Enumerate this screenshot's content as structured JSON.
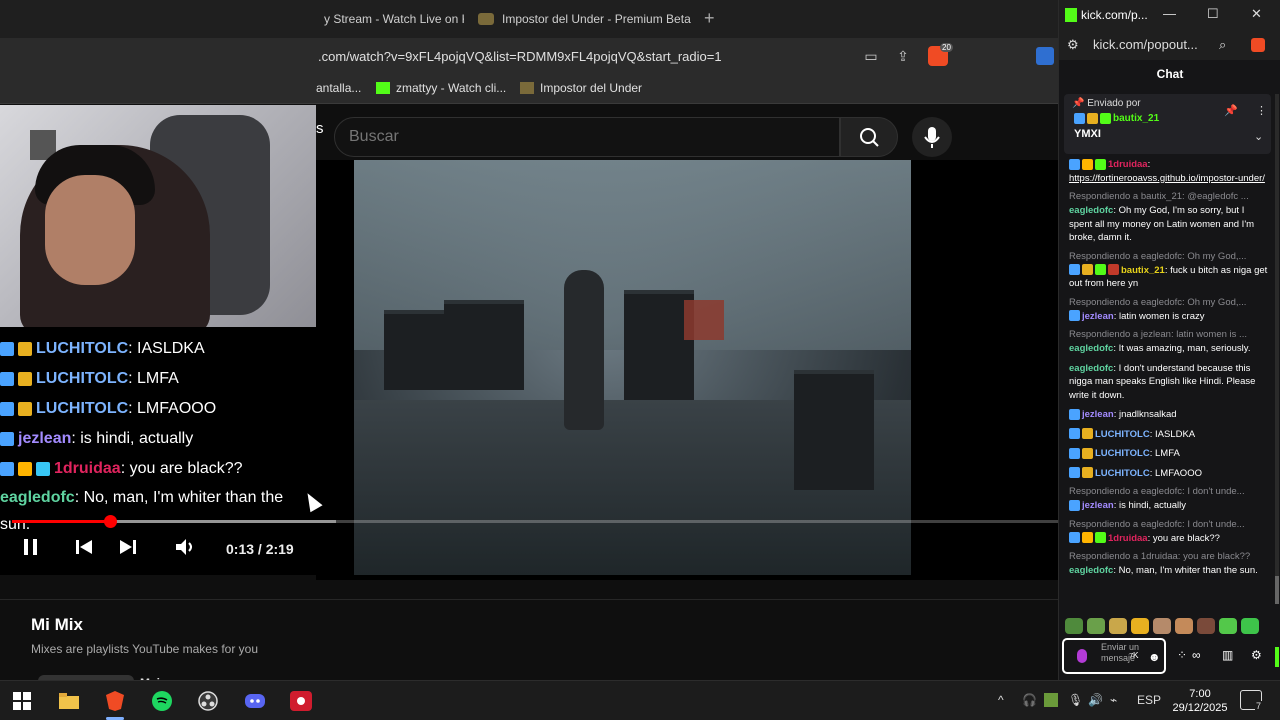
{
  "browser": {
    "tabs": [
      {
        "label": "y Stream - Watch Live on K",
        "favicon_color": "#53fc18"
      },
      {
        "label": "Impostor del Under - Premium Beta",
        "favicon_color": "#7a6a3a"
      }
    ],
    "new_tab": "+",
    "url": ".com/watch?v=9xFL4pojqVQ&list=RDMM9xFL4pojqVQ&start_radio=1",
    "brave_count": "20",
    "bookmarks": [
      {
        "label": "antalla...",
        "color": "#888888"
      },
      {
        "label": "zmattyy - Watch cli...",
        "color": "#53fc18"
      },
      {
        "label": "Impostor del Under",
        "color": "#7a6a3a"
      }
    ]
  },
  "youtube": {
    "logo_fragment": "s",
    "search_placeholder": "Buscar",
    "player": {
      "current_time": "0:13",
      "duration": "2:19",
      "time_display": "0:13 / 2:19",
      "progress": 0.094,
      "buffered": 0.31
    },
    "mix": {
      "title": "Mi Mix",
      "subtitle": "Mixes are playlists YouTube makes for you",
      "next_title": "Majora"
    }
  },
  "overlay_chat": [
    {
      "user": "LUCHITOLC",
      "text": ": IASLDKA",
      "color": "#7db4ff",
      "badges": [
        "sword",
        "sub"
      ]
    },
    {
      "user": "LUCHITOLC",
      "text": ": LMFA",
      "color": "#7db4ff",
      "badges": [
        "sword",
        "sub"
      ]
    },
    {
      "user": "LUCHITOLC",
      "text": ": LMFAOOO",
      "color": "#7db4ff",
      "badges": [
        "sword",
        "sub"
      ]
    },
    {
      "user": "jezlean",
      "text": ": is hindi, actually",
      "color": "#a38bff",
      "badges": [
        "sword"
      ]
    },
    {
      "user": "1druidaa",
      "text": ": you are black??",
      "color": "#e0245e",
      "badges": [
        "sword",
        "crown",
        "gem"
      ]
    },
    {
      "user": "eagledofc",
      "text": ": No, man, I'm whiter than the sun.",
      "color": "#5fd3a0",
      "badges": []
    }
  ],
  "kick": {
    "window_title": "kick.com/p...",
    "address": "kick.com/popout...",
    "chat_header": "Chat",
    "pinned": {
      "label": "Enviado por",
      "user": "bautix_21",
      "message": "YMXI"
    },
    "messages": [
      {
        "reply": "",
        "user": "1druidaa",
        "color": "#e0245e",
        "text": ":",
        "link": "https://fortinerooavss.github.io/impostor-under/"
      },
      {
        "reply": "Respondiendo a bautix_21: @eagledofc ...",
        "user": "eagledofc",
        "color": "#5fd3a0",
        "text": ": Oh my God, I'm so sorry, but I spent all my money on Latin women and I'm broke, damn it."
      },
      {
        "reply": "Respondiendo a eagledofc: Oh my God,...",
        "user": "bautix_21",
        "color": "#e7d21a",
        "text": ": fuck u bitch as niga get out from here yn"
      },
      {
        "reply": "Respondiendo a eagledofc: Oh my God,...",
        "user": "jezlean",
        "color": "#a38bff",
        "text": ": latin women is crazy"
      },
      {
        "reply": "Respondiendo a jezlean: latin women is ...",
        "user": "eagledofc",
        "color": "#5fd3a0",
        "text": ": It was amazing, man, seriously."
      },
      {
        "reply": "",
        "user": "eagledofc",
        "color": "#5fd3a0",
        "text": ": I don't understand because this nigga man speaks English like Hindi. Please write it down."
      },
      {
        "reply": "",
        "user": "jezlean",
        "color": "#a38bff",
        "text": ": jnadlknsalkad"
      },
      {
        "reply": "",
        "user": "LUCHITOLC",
        "color": "#7db4ff",
        "text": ": IASLDKA"
      },
      {
        "reply": "",
        "user": "LUCHITOLC",
        "color": "#7db4ff",
        "text": ": LMFA"
      },
      {
        "reply": "",
        "user": "LUCHITOLC",
        "color": "#7db4ff",
        "text": ": LMFAOOO"
      },
      {
        "reply": "Respondiendo a eagledofc: I don't unde...",
        "user": "jezlean",
        "color": "#a38bff",
        "text": ": is hindi, actually"
      },
      {
        "reply": "Respondiendo a eagledofc: I don't unde...",
        "user": "1druidaa",
        "color": "#e0245e",
        "text": ": you are black??"
      },
      {
        "reply": "Respondiendo a 1druidaa: you are black??",
        "user": "eagledofc",
        "color": "#5fd3a0",
        "text": ": No, man, I'm whiter than the sun."
      }
    ],
    "input_placeholder": "Enviar un mensaje"
  },
  "taskbar": {
    "language": "ESP",
    "time": "7:00",
    "date": "29/12/2025",
    "notification_count": "7"
  }
}
